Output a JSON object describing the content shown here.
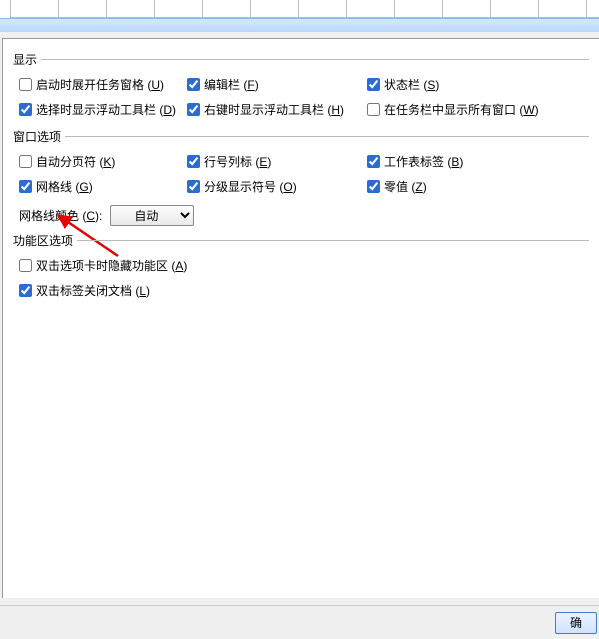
{
  "groups": {
    "display": {
      "title": "显示",
      "items": [
        {
          "label_pre": "启动时展开任务窗格 (",
          "hotkey": "U",
          "label_post": ")",
          "checked": false
        },
        {
          "label_pre": "编辑栏 (",
          "hotkey": "F",
          "label_post": ")",
          "checked": true
        },
        {
          "label_pre": "状态栏 (",
          "hotkey": "S",
          "label_post": ")",
          "checked": true
        },
        {
          "label_pre": "选择时显示浮动工具栏 (",
          "hotkey": "D",
          "label_post": ")",
          "checked": true
        },
        {
          "label_pre": "右键时显示浮动工具栏 (",
          "hotkey": "H",
          "label_post": ")",
          "checked": true
        },
        {
          "label_pre": "在任务栏中显示所有窗口 (",
          "hotkey": "W",
          "label_post": ")",
          "checked": false
        }
      ]
    },
    "window": {
      "title": "窗口选项",
      "items": [
        {
          "label_pre": "自动分页符 (",
          "hotkey": "K",
          "label_post": ")",
          "checked": false
        },
        {
          "label_pre": "行号列标 (",
          "hotkey": "E",
          "label_post": ")",
          "checked": true
        },
        {
          "label_pre": "工作表标签 (",
          "hotkey": "B",
          "label_post": ")",
          "checked": true
        },
        {
          "label_pre": "网格线 (",
          "hotkey": "G",
          "label_post": ")",
          "checked": true
        },
        {
          "label_pre": "分级显示符号 (",
          "hotkey": "O",
          "label_post": ")",
          "checked": true
        },
        {
          "label_pre": "零值 (",
          "hotkey": "Z",
          "label_post": ")",
          "checked": true
        }
      ],
      "gridcolor": {
        "label_pre": "网格线颜色 (",
        "hotkey": "C",
        "label_post": "):",
        "value": "自动"
      }
    },
    "ribbon": {
      "title": "功能区选项",
      "items": [
        {
          "label_pre": "双击选项卡时隐藏功能区 (",
          "hotkey": "A",
          "label_post": ")",
          "checked": false
        },
        {
          "label_pre": "双击标签关闭文档 (",
          "hotkey": "L",
          "label_post": ")",
          "checked": true
        }
      ]
    }
  },
  "footer": {
    "ok_label": "确"
  }
}
